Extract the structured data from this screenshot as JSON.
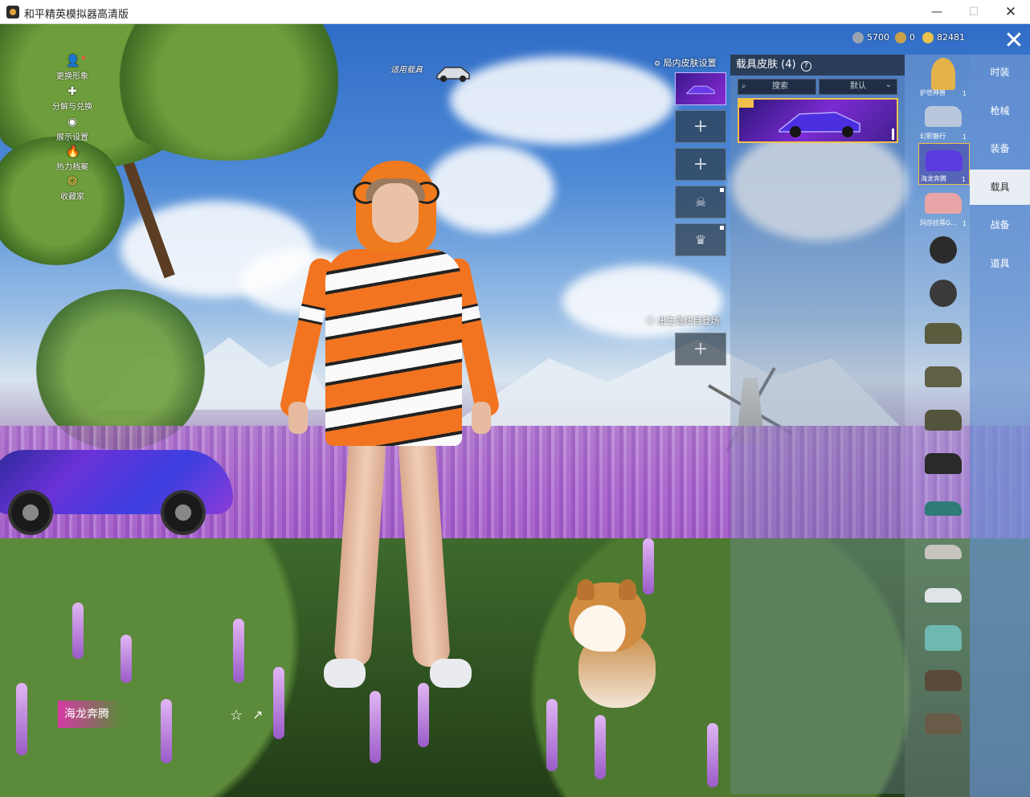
{
  "window": {
    "title": "和平精英模拟器高清版",
    "min_glyph": "—",
    "max_glyph": "☐",
    "close_glyph": "✕"
  },
  "currency": [
    {
      "icon": "silver-coin-icon",
      "value": "5700",
      "color": "#9aa3b0"
    },
    {
      "icon": "medal-coin-icon",
      "value": "0",
      "color": "#caa24a"
    },
    {
      "icon": "gold-coin-icon",
      "value": "82481",
      "color": "#e8c24a"
    }
  ],
  "left_menu": [
    {
      "icon": "person-icon",
      "glyph": "👤",
      "label": "更换形象"
    },
    {
      "icon": "puzzle-icon",
      "glyph": "✚",
      "label": "分解与兑换"
    },
    {
      "icon": "eye-icon",
      "glyph": "◉",
      "label": "展示设置"
    },
    {
      "icon": "flame-icon",
      "glyph": "🔥",
      "label": "热力档案"
    },
    {
      "icon": "collection-icon",
      "glyph": "❂",
      "label": "收藏家"
    }
  ],
  "applied_vehicle_label": "适用载具",
  "slots": {
    "in_game_title": "局内皮肤设置",
    "spawn_title": "出生岛炫目登场",
    "plus_glyph": "+",
    "skull_glyph": "☠",
    "crown_glyph": "♛"
  },
  "skin_panel": {
    "title": "载具皮肤 (4)",
    "help_glyph": "?",
    "search_placeholder": "搜索",
    "search_glyph": "⌕",
    "sort_label": "默认",
    "sort_glyph": "⌄"
  },
  "vehicles": [
    {
      "name": "护世神兽",
      "count": "1",
      "color": "#e3b24a"
    },
    {
      "name": "幻影魅行",
      "count": "1",
      "color": "#b8c7dc"
    },
    {
      "name": "海龙奔腾",
      "count": "1",
      "color": "#5b3ae0"
    },
    {
      "name": "玛莎拉蒂G...",
      "count": "1",
      "color": "#e7a5a8"
    },
    {
      "name": "",
      "count": "",
      "color": "#2b2b2b"
    },
    {
      "name": "",
      "count": "",
      "color": "#3a3a3a"
    },
    {
      "name": "",
      "count": "",
      "color": "#5b5b3e"
    },
    {
      "name": "",
      "count": "",
      "color": "#606046"
    },
    {
      "name": "",
      "count": "",
      "color": "#54543c"
    },
    {
      "name": "",
      "count": "",
      "color": "#2a2a2a"
    },
    {
      "name": "",
      "count": "",
      "color": "#2e7b7a"
    },
    {
      "name": "",
      "count": "",
      "color": "#c7c3bd"
    },
    {
      "name": "",
      "count": "",
      "color": "#e0e3e8"
    },
    {
      "name": "",
      "count": "",
      "color": "#6fb8b0"
    },
    {
      "name": "",
      "count": "",
      "color": "#5a4a3a"
    },
    {
      "name": "",
      "count": "",
      "color": "#6a5a48"
    }
  ],
  "tabs": [
    "时装",
    "枪械",
    "装备",
    "载具",
    "战备",
    "道具"
  ],
  "active_tab": "载具",
  "close_glyph": "✕",
  "selected_skin_name": "海龙奔腾",
  "favorite_glyph": "☆",
  "share_glyph": "↗"
}
